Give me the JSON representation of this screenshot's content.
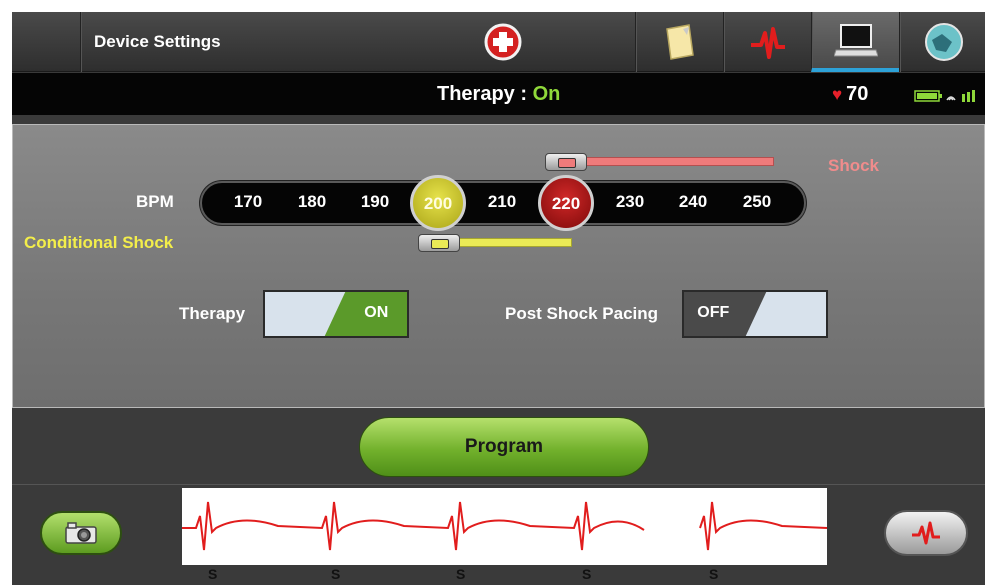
{
  "header": {
    "title": "Device Settings",
    "tabs": [
      {
        "name": "emergency",
        "icon": "medical-cross-icon"
      },
      {
        "name": "notes",
        "icon": "notepad-icon"
      },
      {
        "name": "ecg",
        "icon": "ecg-wave-icon"
      },
      {
        "name": "device",
        "icon": "laptop-icon",
        "active": true
      },
      {
        "name": "map",
        "icon": "globe-icon"
      }
    ],
    "accent_color": "#2da2d8"
  },
  "status": {
    "therapy_label": "Therapy : ",
    "therapy_value": "On",
    "heart_rate": "70",
    "heart_icon": "♥"
  },
  "settings": {
    "bpm_label": "BPM",
    "conditional_shock_label": "Conditional Shock",
    "shock_label": "Shock",
    "bpm_ticks": [
      "170",
      "180",
      "190",
      "210",
      "230",
      "240",
      "250"
    ],
    "conditional_shock_value": "200",
    "shock_value": "220",
    "therapy_toggle_label": "Therapy",
    "therapy_toggle_value": "ON",
    "post_shock_pacing_label": "Post Shock Pacing",
    "post_shock_pacing_value": "OFF"
  },
  "actions": {
    "program_label": "Program"
  },
  "ecg": {
    "markers": [
      "S",
      "S",
      "S",
      "S",
      "S"
    ]
  }
}
